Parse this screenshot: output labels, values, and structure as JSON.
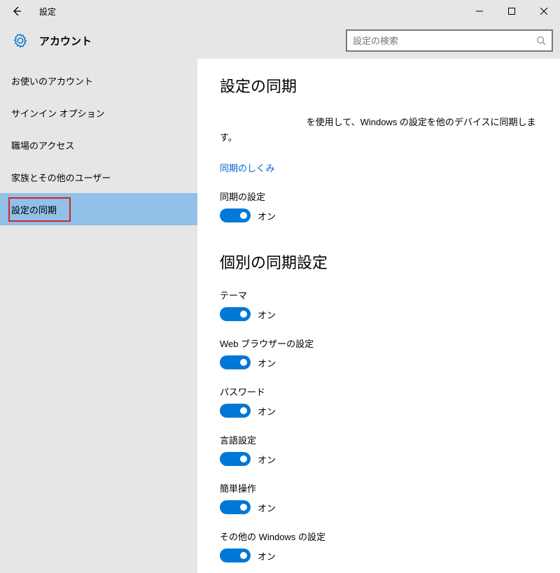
{
  "window": {
    "title": "設定"
  },
  "header": {
    "page_title": "アカウント",
    "search_placeholder": "設定の検索"
  },
  "sidebar": {
    "items": [
      {
        "label": "お使いのアカウント"
      },
      {
        "label": "サインイン オプション"
      },
      {
        "label": "職場のアクセス"
      },
      {
        "label": "家族とその他のユーザー"
      },
      {
        "label": "設定の同期"
      }
    ]
  },
  "main": {
    "heading": "設定の同期",
    "desc_suffix": "を使用して、Windows の設定を他のデバイスに同期します。",
    "link": "同期のしくみ",
    "sync_settings_label": "同期の設定",
    "on_label": "オン",
    "individual_heading": "個別の同期設定",
    "items": [
      {
        "label": "テーマ"
      },
      {
        "label": "Web ブラウザーの設定"
      },
      {
        "label": "パスワード"
      },
      {
        "label": "言語設定"
      },
      {
        "label": "簡単操作"
      },
      {
        "label": "その他の Windows の設定"
      }
    ]
  }
}
